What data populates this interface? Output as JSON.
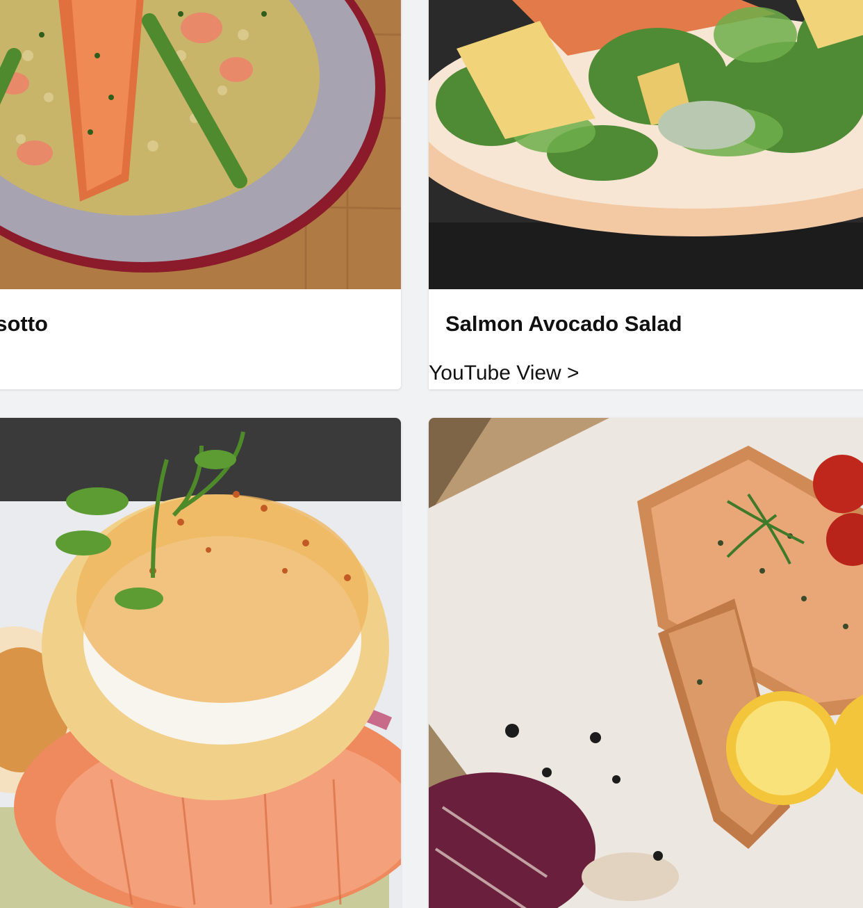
{
  "cards": [
    {
      "title": "sotto",
      "link": "",
      "image": "salmon-risotto-photo"
    },
    {
      "title": "Salmon Avocado Salad",
      "link": "YouTube View >",
      "image": "salmon-avocado-salad-photo"
    },
    {
      "title": "",
      "link": "",
      "image": "smoked-salmon-eggs-benedict-photo"
    },
    {
      "title": "",
      "link": "",
      "image": "grilled-salmon-lemon-photo"
    }
  ]
}
